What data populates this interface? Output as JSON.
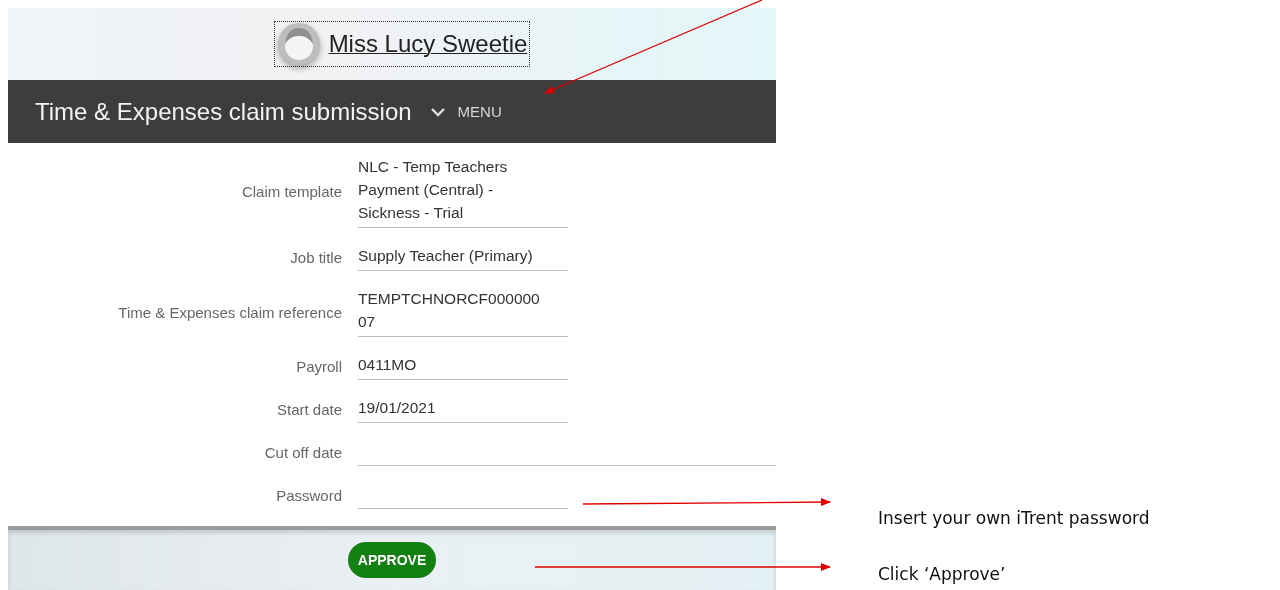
{
  "header": {
    "user_name": "Miss Lucy Sweetie"
  },
  "nav": {
    "title": "Time & Expenses claim submission",
    "menu_label": "MENU"
  },
  "form": {
    "fields": [
      {
        "label": "Claim template",
        "kind": "readonly",
        "lines": [
          "NLC - Temp Teachers",
          "Payment (Central) -",
          "Sickness - Trial"
        ]
      },
      {
        "label": "Job title",
        "kind": "readonly",
        "lines": [
          "Supply Teacher (Primary)"
        ]
      },
      {
        "label": "Time & Expenses claim reference",
        "kind": "readonly",
        "lines": [
          "TEMPTCHNORCF000000",
          "07"
        ]
      },
      {
        "label": "Payroll",
        "kind": "readonly",
        "lines": [
          "0411MO"
        ]
      },
      {
        "label": "Start date",
        "kind": "readonly",
        "lines": [
          "19/01/2021"
        ]
      },
      {
        "label": "Cut off date",
        "kind": "date"
      },
      {
        "label": "Password",
        "kind": "password"
      }
    ]
  },
  "footer": {
    "button": "APPROVE"
  },
  "annotations": [
    {
      "text": "Insert your own iTrent password"
    },
    {
      "text": "Click ‘Approve’"
    }
  ]
}
